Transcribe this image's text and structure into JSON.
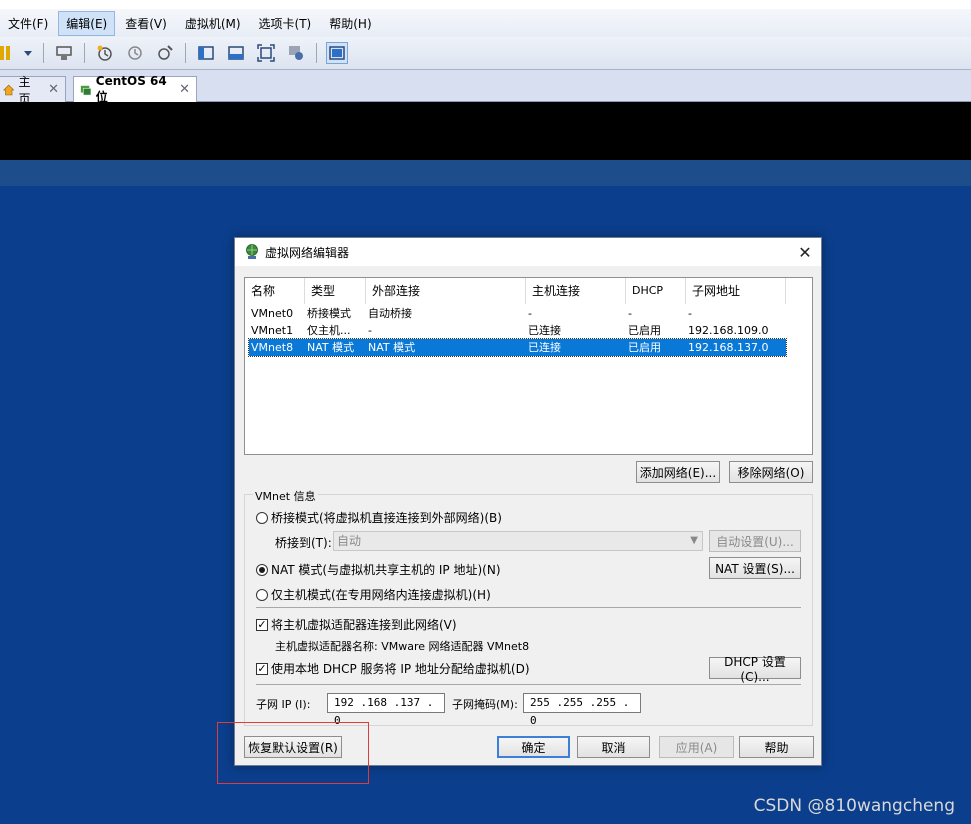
{
  "menu": {
    "items": [
      "文件(F)",
      "编辑(E)",
      "查看(V)",
      "虚拟机(M)",
      "选项卡(T)",
      "帮助(H)"
    ]
  },
  "tabs": {
    "home": "主页",
    "vm": "CentOS 64 位"
  },
  "dialog": {
    "title": "虚拟网络编辑器",
    "columns": [
      "名称",
      "类型",
      "外部连接",
      "主机连接",
      "DHCP",
      "子网地址"
    ],
    "rows": [
      {
        "name": "VMnet0",
        "type": "桥接模式",
        "external": "自动桥接",
        "host": "-",
        "dhcp": "-",
        "subnet": "-"
      },
      {
        "name": "VMnet1",
        "type": "仅主机...",
        "external": "-",
        "host": "已连接",
        "dhcp": "已启用",
        "subnet": "192.168.109.0"
      },
      {
        "name": "VMnet8",
        "type": "NAT 模式",
        "external": "NAT 模式",
        "host": "已连接",
        "dhcp": "已启用",
        "subnet": "192.168.137.0"
      }
    ],
    "add_network": "添加网络(E)...",
    "remove_network": "移除网络(O)",
    "group_title": "VMnet 信息",
    "bridged_radio": "桥接模式(将虚拟机直接连接到外部网络)(B)",
    "bridge_to_label": "桥接到(T):",
    "bridge_to_value": "自动",
    "auto_settings": "自动设置(U)...",
    "nat_radio": "NAT 模式(与虚拟机共享主机的 IP 地址)(N)",
    "nat_settings": "NAT 设置(S)...",
    "hostonly_radio": "仅主机模式(在专用网络内连接虚拟机)(H)",
    "connect_adapter": "将主机虚拟适配器连接到此网络(V)",
    "adapter_name": "主机虚拟适配器名称: VMware 网络适配器 VMnet8",
    "use_dhcp": "使用本地 DHCP 服务将 IP 地址分配给虚拟机(D)",
    "dhcp_settings": "DHCP 设置(C)...",
    "subnet_ip_label": "子网 IP (I):",
    "subnet_ip": "192 .168 .137 .  0",
    "subnet_mask_label": "子网掩码(M):",
    "subnet_mask": "255 .255 .255 .  0",
    "restore_defaults": "恢复默认设置(R)",
    "ok": "确定",
    "cancel": "取消",
    "apply": "应用(A)",
    "help": "帮助"
  },
  "watermark": "CSDN @810wangcheng",
  "colors": {
    "selection": "#0a78d7",
    "vm_background": "#0b3e8c",
    "highlight_box": "#e03a3a"
  }
}
